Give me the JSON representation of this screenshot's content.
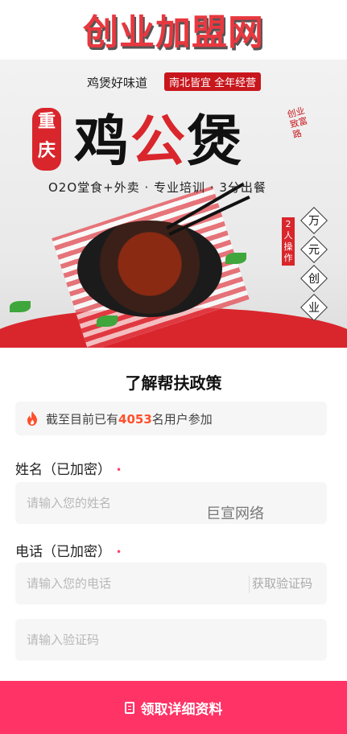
{
  "header": {
    "site_title": "创业加盟网"
  },
  "banner": {
    "tagline": "鸡煲好味道",
    "pill": "南北皆宜 全年经营",
    "seal": "重庆",
    "brand_a": "鸡",
    "brand_b": "公",
    "brand_c": "煲",
    "side_small": "创业致富路",
    "subline": "O2O堂食+外卖 · 专业培训 · 3分出餐",
    "badge": "2人操作",
    "diamonds": [
      "万",
      "元",
      "创",
      "业"
    ]
  },
  "section": {
    "title": "了解帮扶政策"
  },
  "stat": {
    "prefix": "截至目前已有",
    "count": "4053",
    "suffix": "名用户参加"
  },
  "form": {
    "name_label": "姓名（已加密）",
    "name_placeholder": "请输入您的姓名",
    "phone_label": "电话（已加密）",
    "phone_placeholder": "请输入您的电话",
    "get_code_label": "获取验证码",
    "code_placeholder": "请输入验证码",
    "required_mark": "•"
  },
  "watermark": "巨宣网络",
  "submit_label": "领取详细资料",
  "colors": {
    "accent": "#ff3366",
    "count": "#ff4f2c",
    "brand_red": "#d9262c"
  }
}
